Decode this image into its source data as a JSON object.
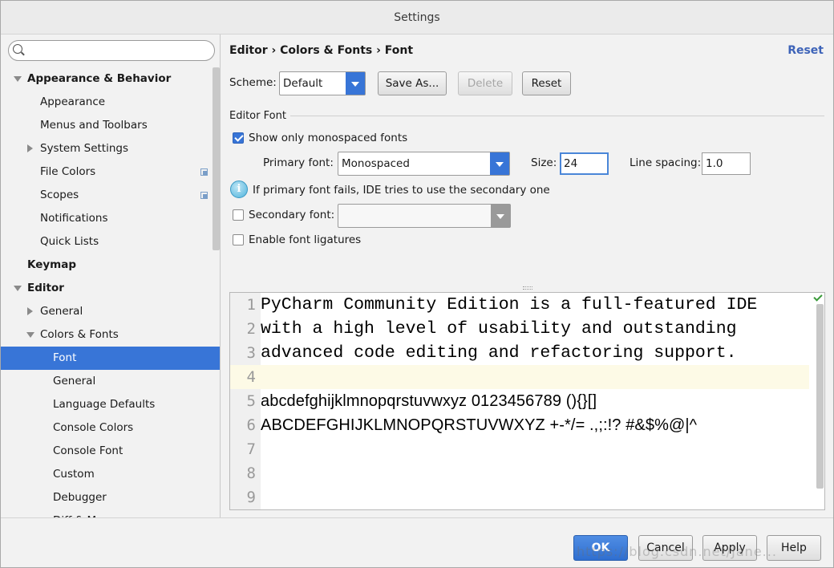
{
  "window": {
    "title": "Settings"
  },
  "search": {
    "placeholder": ""
  },
  "sidebar": {
    "items": [
      {
        "label": "Appearance & Behavior",
        "level": 0,
        "expander": "down",
        "bold": true
      },
      {
        "label": "Appearance",
        "level": 1
      },
      {
        "label": "Menus and Toolbars",
        "level": 1
      },
      {
        "label": "System Settings",
        "level": 1,
        "expander": "right"
      },
      {
        "label": "File Colors",
        "level": 1,
        "copy_icon": true
      },
      {
        "label": "Scopes",
        "level": 1,
        "copy_icon": true
      },
      {
        "label": "Notifications",
        "level": 1
      },
      {
        "label": "Quick Lists",
        "level": 1
      },
      {
        "label": "Keymap",
        "level": 0,
        "bold": true
      },
      {
        "label": "Editor",
        "level": 0,
        "expander": "down",
        "bold": true
      },
      {
        "label": "General",
        "level": 1,
        "expander": "right"
      },
      {
        "label": "Colors & Fonts",
        "level": 1,
        "expander": "down"
      },
      {
        "label": "Font",
        "level": 2,
        "selected": true
      },
      {
        "label": "General",
        "level": 2
      },
      {
        "label": "Language Defaults",
        "level": 2
      },
      {
        "label": "Console Colors",
        "level": 2
      },
      {
        "label": "Console Font",
        "level": 2
      },
      {
        "label": "Custom",
        "level": 2
      },
      {
        "label": "Debugger",
        "level": 2
      },
      {
        "label": "Diff & Merge",
        "level": 2
      }
    ]
  },
  "header": {
    "breadcrumb": "Editor › Colors & Fonts › Font",
    "reset_link": "Reset"
  },
  "scheme": {
    "label": "Scheme:",
    "value": "Default",
    "save_as": "Save As...",
    "delete": "Delete",
    "reset": "Reset"
  },
  "editor_font": {
    "section": "Editor Font",
    "show_mono_label": "Show only monospaced fonts",
    "show_mono_checked": true,
    "primary_label": "Primary font:",
    "primary_value": "Monospaced",
    "size_label": "Size:",
    "size_value": "24",
    "spacing_label": "Line spacing:",
    "spacing_value": "1.0",
    "info_text": "If primary font fails, IDE tries to use the secondary one",
    "secondary_label": "Secondary font:",
    "secondary_checked": false,
    "secondary_value": "",
    "ligatures_label": "Enable font ligatures",
    "ligatures_checked": false
  },
  "preview": {
    "lines": [
      {
        "n": "1",
        "text": "PyCharm Community Edition is a full-featured IDE",
        "style": "mono"
      },
      {
        "n": "2",
        "text": "with a high level of usability and outstanding",
        "style": "mono"
      },
      {
        "n": "3",
        "text": "advanced code editing and refactoring support.",
        "style": "mono"
      },
      {
        "n": "4",
        "text": "",
        "style": "mono",
        "current": true
      },
      {
        "n": "5",
        "text": "abcdefghijklmnopqrstuvwxyz 0123456789 (){}[]",
        "style": "sans"
      },
      {
        "n": "6",
        "text": "ABCDEFGHIJKLMNOPQRSTUVWXYZ +-*/= .,;:!? #&$%@|^",
        "style": "sans"
      },
      {
        "n": "7",
        "text": "",
        "style": "mono"
      },
      {
        "n": "8",
        "text": "",
        "style": "mono"
      },
      {
        "n": "9",
        "text": "",
        "style": "mono"
      }
    ]
  },
  "footer": {
    "ok": "OK",
    "cancel": "Cancel",
    "apply": "Apply",
    "help": "Help",
    "watermark": "https://blog.csdn.net/Jane..."
  },
  "colors": {
    "accent": "#3875d7",
    "current_line": "#fdfae6",
    "link": "#3d63b8"
  }
}
